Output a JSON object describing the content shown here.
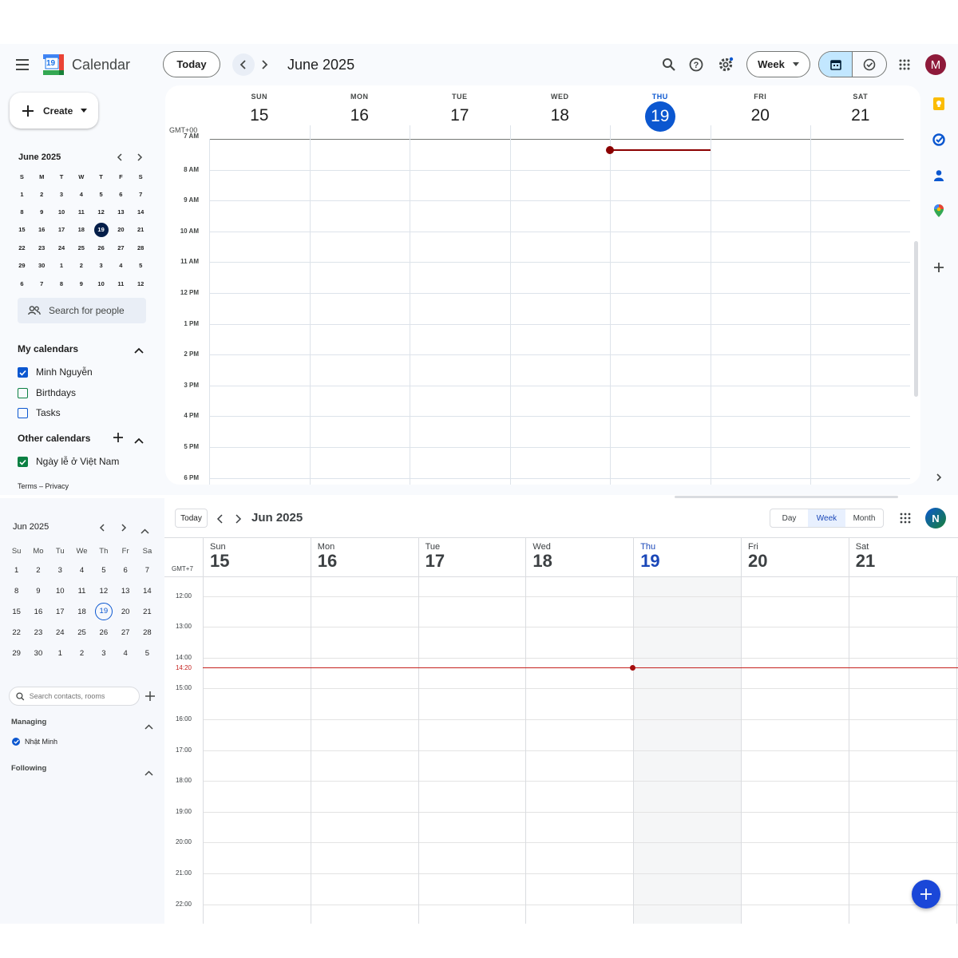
{
  "top": {
    "app_title": "Calendar",
    "logo_day": "19",
    "today_button": "Today",
    "period_label": "June 2025",
    "view_select": "Week",
    "avatar_letter": "M",
    "avatar_color": "#8e1a3a",
    "timezone": "GMT+00",
    "days": [
      {
        "name": "SUN",
        "date": "15"
      },
      {
        "name": "MON",
        "date": "16"
      },
      {
        "name": "TUE",
        "date": "17"
      },
      {
        "name": "WED",
        "date": "18"
      },
      {
        "name": "THU",
        "date": "19"
      },
      {
        "name": "FRI",
        "date": "20"
      },
      {
        "name": "SAT",
        "date": "21"
      }
    ],
    "time_labels": [
      "7 AM",
      "8 AM",
      "9 AM",
      "10 AM",
      "11 AM",
      "12 PM",
      "1 PM",
      "2 PM",
      "3 PM",
      "4 PM",
      "5 PM",
      "6 PM"
    ],
    "sidebar": {
      "create_label": "Create",
      "mini_month": "June 2025",
      "weekday_initials": [
        "S",
        "M",
        "T",
        "W",
        "T",
        "F",
        "S"
      ],
      "weeks": [
        [
          "1",
          "2",
          "3",
          "4",
          "5",
          "6",
          "7"
        ],
        [
          "8",
          "9",
          "10",
          "11",
          "12",
          "13",
          "14"
        ],
        [
          "15",
          "16",
          "17",
          "18",
          "19",
          "20",
          "21"
        ],
        [
          "22",
          "23",
          "24",
          "25",
          "26",
          "27",
          "28"
        ],
        [
          "29",
          "30",
          "1",
          "2",
          "3",
          "4",
          "5"
        ],
        [
          "6",
          "7",
          "8",
          "9",
          "10",
          "11",
          "12"
        ]
      ],
      "search_people": "Search for people",
      "my_calendars_title": "My calendars",
      "my_calendars": [
        {
          "label": "Minh Nguyễn",
          "checked": true,
          "color": "#0b57d0"
        },
        {
          "label": "Birthdays",
          "checked": false,
          "color": "#0b8043"
        },
        {
          "label": "Tasks",
          "checked": false,
          "color": "#0b57d0"
        }
      ],
      "other_calendars_title": "Other calendars",
      "other_calendars": [
        {
          "label": "Ngày lễ ở Việt Nam",
          "checked": true,
          "color": "#0b8043"
        }
      ],
      "footer": "Terms – Privacy"
    }
  },
  "bottom": {
    "today_button": "Today",
    "period_label": "Jun 2025",
    "views": [
      "Day",
      "Week",
      "Month"
    ],
    "active_view": "Week",
    "avatar_letter": "N",
    "timezone": "GMT+7",
    "now_label": "14:20",
    "days": [
      {
        "name": "Sun",
        "date": "15"
      },
      {
        "name": "Mon",
        "date": "16"
      },
      {
        "name": "Tue",
        "date": "17"
      },
      {
        "name": "Wed",
        "date": "18"
      },
      {
        "name": "Thu",
        "date": "19"
      },
      {
        "name": "Fri",
        "date": "20"
      },
      {
        "name": "Sat",
        "date": "21"
      }
    ],
    "time_labels": [
      "12:00",
      "13:00",
      "14:00",
      "15:00",
      "16:00",
      "17:00",
      "18:00",
      "19:00",
      "20:00",
      "21:00",
      "22:00"
    ],
    "sidebar": {
      "mini_month": "Jun 2025",
      "weekday_names": [
        "Su",
        "Mo",
        "Tu",
        "We",
        "Th",
        "Fr",
        "Sa"
      ],
      "weeks": [
        [
          "1",
          "2",
          "3",
          "4",
          "5",
          "6",
          "7"
        ],
        [
          "8",
          "9",
          "10",
          "11",
          "12",
          "13",
          "14"
        ],
        [
          "15",
          "16",
          "17",
          "18",
          "19",
          "20",
          "21"
        ],
        [
          "22",
          "23",
          "24",
          "25",
          "26",
          "27",
          "28"
        ],
        [
          "29",
          "30",
          "1",
          "2",
          "3",
          "4",
          "5"
        ]
      ],
      "search_placeholder": "Search contacts, rooms",
      "managing_title": "Managing",
      "managing_items": [
        "Nhật Minh"
      ],
      "following_title": "Following"
    }
  }
}
